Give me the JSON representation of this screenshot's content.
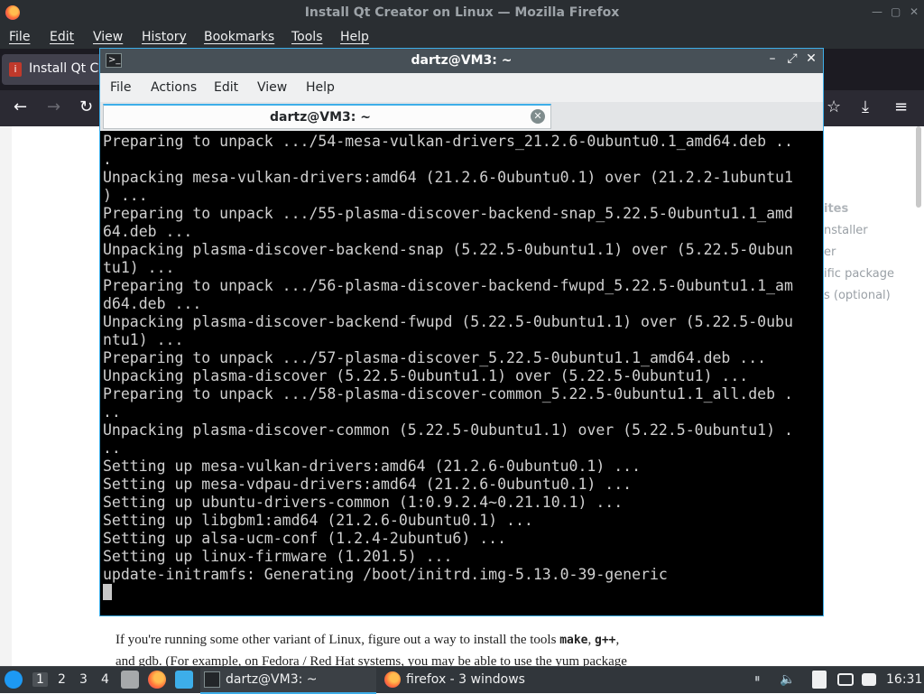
{
  "firefox": {
    "window_title": "Install Qt Creator on Linux — Mozilla Firefox",
    "menu": [
      "File",
      "Edit",
      "View",
      "History",
      "Bookmarks",
      "Tools",
      "Help"
    ],
    "tab_title": "Install Qt Cr",
    "sidebar_heading": "ites",
    "sidebar_links": [
      "nstaller",
      "er",
      "ific package",
      "s (optional)"
    ],
    "page_line1_pre": "If you're running some other variant of Linux, figure out a way to install the tools ",
    "page_line1_make": "make",
    "page_line1_sep": ", ",
    "page_line1_gpp": "g++",
    "page_line1_end": ",",
    "page_line2": "and gdb. (For example, on Fedora / Red Hat systems, you may be able to use the yum package"
  },
  "terminal": {
    "window_title": "dartz@VM3: ~",
    "menu": [
      "File",
      "Actions",
      "Edit",
      "View",
      "Help"
    ],
    "tab_label": "dartz@VM3: ~",
    "lines": [
      "Preparing to unpack .../54-mesa-vulkan-drivers_21.2.6-0ubuntu0.1_amd64.deb ..",
      ".",
      "Unpacking mesa-vulkan-drivers:amd64 (21.2.6-0ubuntu0.1) over (21.2.2-1ubuntu1",
      ") ...",
      "Preparing to unpack .../55-plasma-discover-backend-snap_5.22.5-0ubuntu1.1_amd",
      "64.deb ...",
      "Unpacking plasma-discover-backend-snap (5.22.5-0ubuntu1.1) over (5.22.5-0ubun",
      "tu1) ...",
      "Preparing to unpack .../56-plasma-discover-backend-fwupd_5.22.5-0ubuntu1.1_am",
      "d64.deb ...",
      "Unpacking plasma-discover-backend-fwupd (5.22.5-0ubuntu1.1) over (5.22.5-0ubu",
      "ntu1) ...",
      "Preparing to unpack .../57-plasma-discover_5.22.5-0ubuntu1.1_amd64.deb ...",
      "Unpacking plasma-discover (5.22.5-0ubuntu1.1) over (5.22.5-0ubuntu1) ...",
      "Preparing to unpack .../58-plasma-discover-common_5.22.5-0ubuntu1.1_all.deb .",
      "..",
      "Unpacking plasma-discover-common (5.22.5-0ubuntu1.1) over (5.22.5-0ubuntu1) .",
      "..",
      "Setting up mesa-vulkan-drivers:amd64 (21.2.6-0ubuntu0.1) ...",
      "Setting up mesa-vdpau-drivers:amd64 (21.2.6-0ubuntu0.1) ...",
      "Setting up ubuntu-drivers-common (1:0.9.2.4~0.21.10.1) ...",
      "Setting up libgbm1:amd64 (21.2.6-0ubuntu0.1) ...",
      "Setting up alsa-ucm-conf (1.2.4-2ubuntu6) ...",
      "Setting up linux-firmware (1.201.5) ...",
      "update-initramfs: Generating /boot/initrd.img-5.13.0-39-generic"
    ]
  },
  "taskbar": {
    "workspaces": [
      "1",
      "2",
      "3",
      "4"
    ],
    "tasks": [
      "dartz@VM3: ~",
      "firefox - 3 windows"
    ],
    "clock": "16:31"
  },
  "colors": {
    "accent": "#3daee9",
    "terminal_bg": "#000000",
    "terminal_fg": "#d0d0d0"
  }
}
